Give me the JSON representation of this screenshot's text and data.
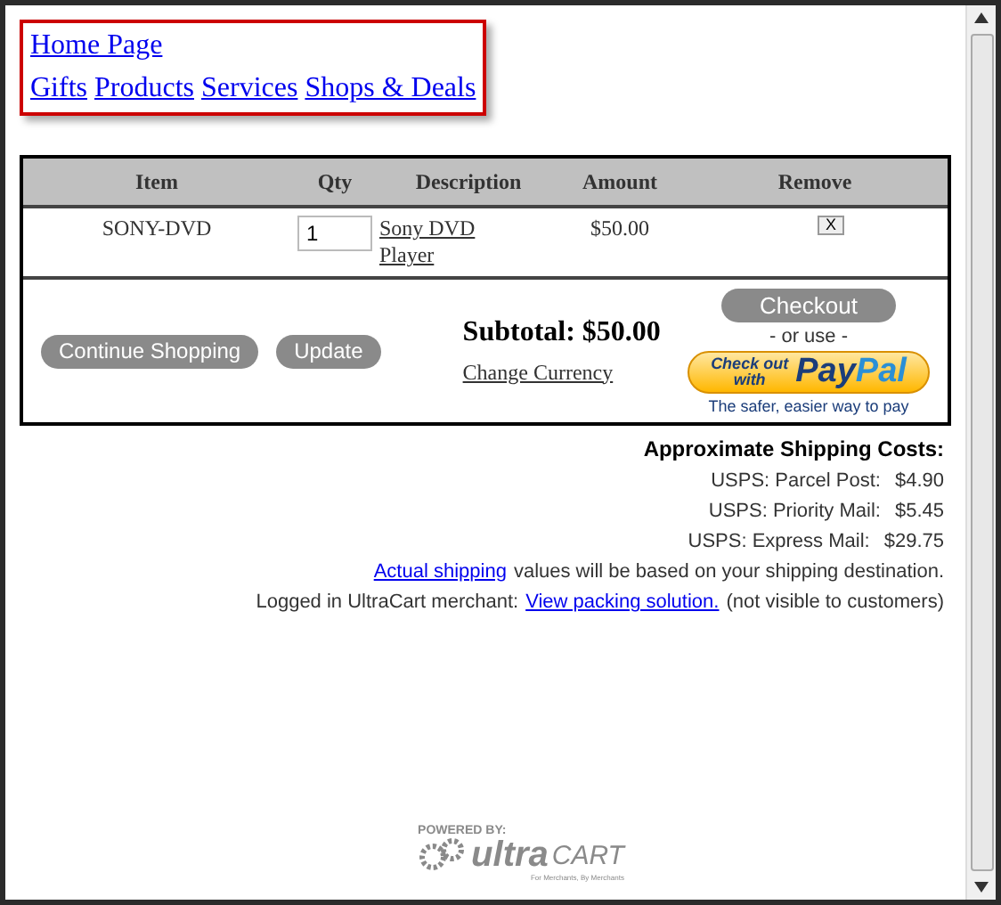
{
  "nav": {
    "home": "Home Page",
    "links": [
      "Gifts",
      "Products",
      "Services",
      "Shops & Deals"
    ]
  },
  "cart": {
    "columns": [
      "Item",
      "Qty",
      "Description",
      "Amount",
      "Remove"
    ],
    "rows": [
      {
        "item": "SONY-DVD",
        "qty": "1",
        "description": "Sony DVD Player",
        "amount": "$50.00",
        "remove": "X"
      }
    ],
    "buttons": [
      "Continue Shopping",
      "Update"
    ],
    "subtotal": "Subtotal: $50.00",
    "change_currency": "Change Currency",
    "checkout": "Checkout",
    "or_use": "- or use -",
    "paypal": {
      "check_out": "Check out",
      "with": "with",
      "brand_pay": "Pay",
      "brand_pal": "Pal",
      "tagline": "The safer, easier way to pay"
    }
  },
  "shipping": {
    "title": "Approximate Shipping Costs:",
    "rates": [
      {
        "method": "USPS: Parcel Post:",
        "price": "$4.90"
      },
      {
        "method": "USPS: Priority Mail:",
        "price": "$5.45"
      },
      {
        "method": "USPS: Express Mail:",
        "price": "$29.75"
      }
    ],
    "note_link": "Actual shipping",
    "note_rest": "values will be based on your shipping destination.",
    "merchant_prefix": "Logged in UltraCart merchant:",
    "merchant_link": "View packing solution.",
    "merchant_suffix": "(not visible to customers)"
  },
  "footer": {
    "powered": "POWERED BY:",
    "brand_a": "ultra",
    "brand_b": "CART",
    "tagline": "For Merchants, By Merchants"
  }
}
